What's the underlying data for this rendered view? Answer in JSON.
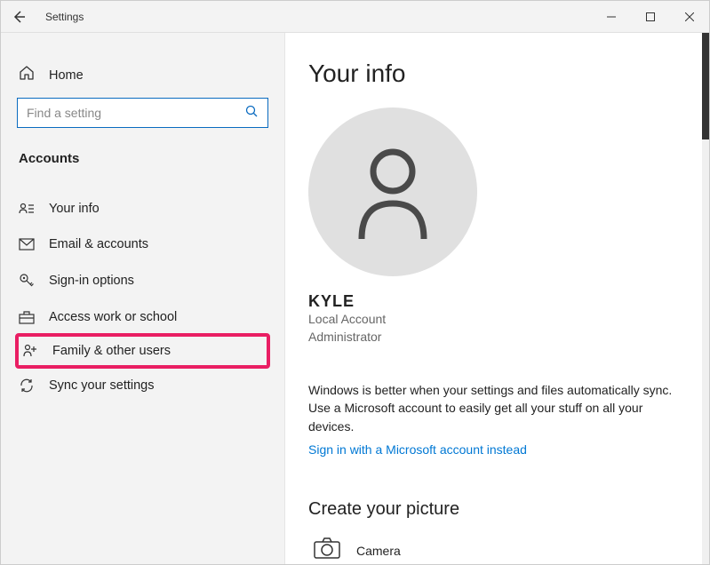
{
  "titlebar": {
    "title": "Settings"
  },
  "sidebar": {
    "home_label": "Home",
    "search_placeholder": "Find a setting",
    "section_header": "Accounts",
    "items": [
      {
        "label": "Your info"
      },
      {
        "label": "Email & accounts"
      },
      {
        "label": "Sign-in options"
      },
      {
        "label": "Access work or school"
      },
      {
        "label": "Family & other users"
      },
      {
        "label": "Sync your settings"
      }
    ]
  },
  "main": {
    "page_title": "Your info",
    "user": {
      "name": "KYLE",
      "type": "Local Account",
      "role": "Administrator"
    },
    "info_line1": "Windows is better when your settings and files automatically sync.",
    "info_line2": "Use a Microsoft account to easily get all your stuff on all your devices.",
    "signin_link": "Sign in with a Microsoft account instead",
    "create_picture_heading": "Create your picture",
    "camera_label": "Camera"
  }
}
